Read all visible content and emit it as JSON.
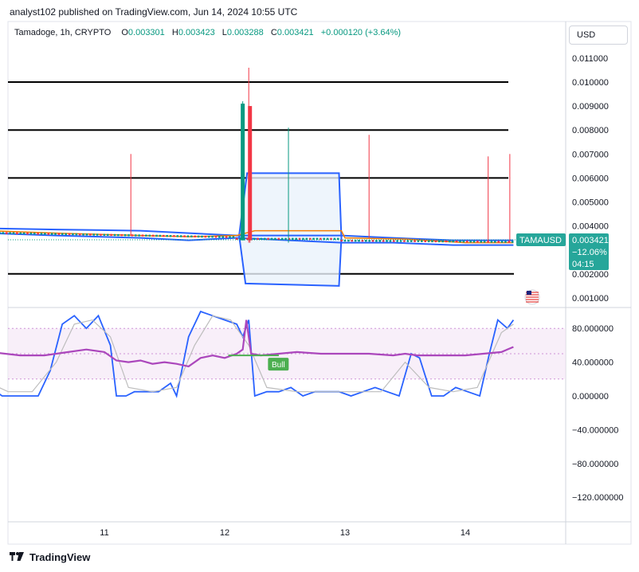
{
  "header": {
    "publisher": "analyst102 published on TradingView.com, Jun 14, 2024 10:55 UTC"
  },
  "legend": {
    "symbol": "Tamadoge, 1h, CRYPTO",
    "o_label": "O",
    "o_value": "0.003301",
    "h_label": "H",
    "h_value": "0.003423",
    "l_label": "L",
    "l_value": "0.003288",
    "c_label": "C",
    "c_value": "0.003421",
    "change": "+0.000120 (+3.64%)"
  },
  "currency_button": {
    "label": "USD"
  },
  "badge": {
    "ticker": "TAMAUSD",
    "price": "0.003421",
    "pct": "−12.06%",
    "countdown": "04:15"
  },
  "bull_label": "Bull",
  "footer": {
    "brand": "TradingView"
  },
  "colors": {
    "up": "#089981",
    "down": "#f23645",
    "bollinger": "#2962ff",
    "ma_orange": "#f57c00",
    "stoch_k": "#2962ff",
    "stoch_d": "#bdbdbd",
    "rsi": "#ab47bc",
    "badge": "#26a69a"
  },
  "chart_data": [
    {
      "type": "candlestick",
      "y_ticks": [
        "0.011000",
        "0.010000",
        "0.009000",
        "0.008000",
        "0.007000",
        "0.006000",
        "0.005000",
        "0.004000",
        "0.002000",
        "0.001000"
      ],
      "x_ticks": [
        "11",
        "12",
        "13",
        "14"
      ],
      "ylim": [
        0.0005,
        0.0115
      ],
      "horizontal_levels": [
        0.01,
        0.008,
        0.006,
        0.002
      ],
      "last_price": 0.003421,
      "spikes": [
        {
          "x": 11.22,
          "high": 0.007,
          "low": 0.0036
        },
        {
          "x": 12.2,
          "high": 0.0106,
          "low": 0.0033
        },
        {
          "x": 12.53,
          "high": 0.0081,
          "low": 0.0033
        },
        {
          "x": 13.2,
          "high": 0.0078,
          "low": 0.0035
        },
        {
          "x": 14.19,
          "high": 0.0069,
          "low": 0.0033
        },
        {
          "x": 14.37,
          "high": 0.007,
          "low": 0.0033
        }
      ],
      "big_candles": [
        {
          "x": 12.15,
          "open": 0.0034,
          "close": 0.0091,
          "high": 0.0092,
          "low": 0.0034,
          "dir": "up"
        },
        {
          "x": 12.21,
          "open": 0.009,
          "close": 0.0034,
          "high": 0.009,
          "low": 0.0033,
          "dir": "down"
        }
      ],
      "envelope_box": {
        "x_start": 12.12,
        "x_end": 12.97,
        "top": 0.0062,
        "bottom": 0.0015
      },
      "bollinger_upper": [
        [
          10.05,
          0.0039
        ],
        [
          10.6,
          0.00385
        ],
        [
          11.3,
          0.0038
        ],
        [
          11.7,
          0.0037
        ],
        [
          12.1,
          0.0036
        ],
        [
          12.97,
          0.0036
        ],
        [
          13.4,
          0.0035
        ],
        [
          13.9,
          0.0034
        ],
        [
          14.4,
          0.0034
        ]
      ],
      "bollinger_lower": [
        [
          10.05,
          0.0037
        ],
        [
          10.6,
          0.0036
        ],
        [
          11.3,
          0.0035
        ],
        [
          11.7,
          0.0034
        ],
        [
          12.1,
          0.0035
        ],
        [
          12.97,
          0.0033
        ],
        [
          13.4,
          0.0033
        ],
        [
          13.9,
          0.0032
        ],
        [
          14.4,
          0.0032
        ]
      ],
      "moving_average": [
        [
          10.05,
          0.0038
        ],
        [
          10.6,
          0.0037
        ],
        [
          11.3,
          0.0036
        ],
        [
          11.7,
          0.00355
        ],
        [
          12.1,
          0.0036
        ],
        [
          12.25,
          0.0038
        ],
        [
          12.97,
          0.0038
        ],
        [
          13.0,
          0.0035
        ],
        [
          13.5,
          0.00345
        ],
        [
          14.0,
          0.0033
        ],
        [
          14.4,
          0.0033
        ]
      ]
    },
    {
      "type": "line",
      "y_ticks": [
        "80.000000",
        "40.000000",
        "0.000000",
        "−40.000000",
        "−80.000000",
        "−120.000000"
      ],
      "ylim": [
        -145,
        105
      ],
      "band_upper": 80,
      "band_lower": 20,
      "series": [
        {
          "key": "stoch_k",
          "x": [
            10.05,
            10.15,
            10.3,
            10.45,
            10.55,
            10.65,
            10.75,
            10.85,
            10.95,
            11.05,
            11.1,
            11.18,
            11.25,
            11.35,
            11.45,
            11.55,
            11.6,
            11.7,
            11.8,
            11.9,
            12.0,
            12.1,
            12.15,
            12.2,
            12.25,
            12.35,
            12.45,
            12.55,
            12.65,
            12.75,
            12.85,
            12.95,
            13.05,
            13.15,
            13.25,
            13.35,
            13.45,
            13.55,
            13.62,
            13.72,
            13.82,
            13.92,
            14.02,
            14.12,
            14.2,
            14.27,
            14.35,
            14.4
          ],
          "y": [
            10,
            0,
            0,
            0,
            30,
            85,
            95,
            80,
            95,
            60,
            0,
            0,
            5,
            5,
            5,
            15,
            0,
            70,
            100,
            95,
            90,
            85,
            70,
            90,
            0,
            5,
            5,
            10,
            0,
            5,
            5,
            5,
            0,
            5,
            10,
            5,
            0,
            50,
            45,
            0,
            0,
            10,
            5,
            0,
            50,
            90,
            80,
            90
          ]
        },
        {
          "key": "stoch_d",
          "x": [
            10.05,
            10.2,
            10.4,
            10.6,
            10.75,
            10.9,
            11.05,
            11.2,
            11.4,
            11.6,
            11.75,
            11.9,
            12.05,
            12.2,
            12.35,
            12.6,
            12.9,
            13.1,
            13.3,
            13.5,
            13.7,
            13.9,
            14.1,
            14.3,
            14.4
          ],
          "y": [
            15,
            5,
            5,
            40,
            85,
            90,
            70,
            10,
            5,
            10,
            60,
            95,
            90,
            60,
            10,
            5,
            5,
            5,
            5,
            40,
            10,
            5,
            10,
            75,
            85
          ]
        },
        {
          "key": "rsi",
          "x": [
            10.05,
            10.3,
            10.5,
            10.7,
            10.85,
            11.0,
            11.1,
            11.2,
            11.3,
            11.4,
            11.5,
            11.6,
            11.7,
            11.8,
            11.9,
            12.0,
            12.1,
            12.15,
            12.18,
            12.22,
            12.3,
            12.45,
            12.6,
            12.8,
            13.0,
            13.2,
            13.4,
            13.5,
            13.6,
            13.8,
            14.0,
            14.15,
            14.3,
            14.4
          ],
          "y": [
            52,
            48,
            48,
            52,
            55,
            52,
            42,
            40,
            42,
            38,
            40,
            38,
            35,
            45,
            48,
            45,
            50,
            55,
            90,
            50,
            48,
            50,
            52,
            50,
            50,
            50,
            48,
            50,
            48,
            48,
            48,
            50,
            52,
            58
          ]
        }
      ],
      "flat_level": 48
    }
  ]
}
